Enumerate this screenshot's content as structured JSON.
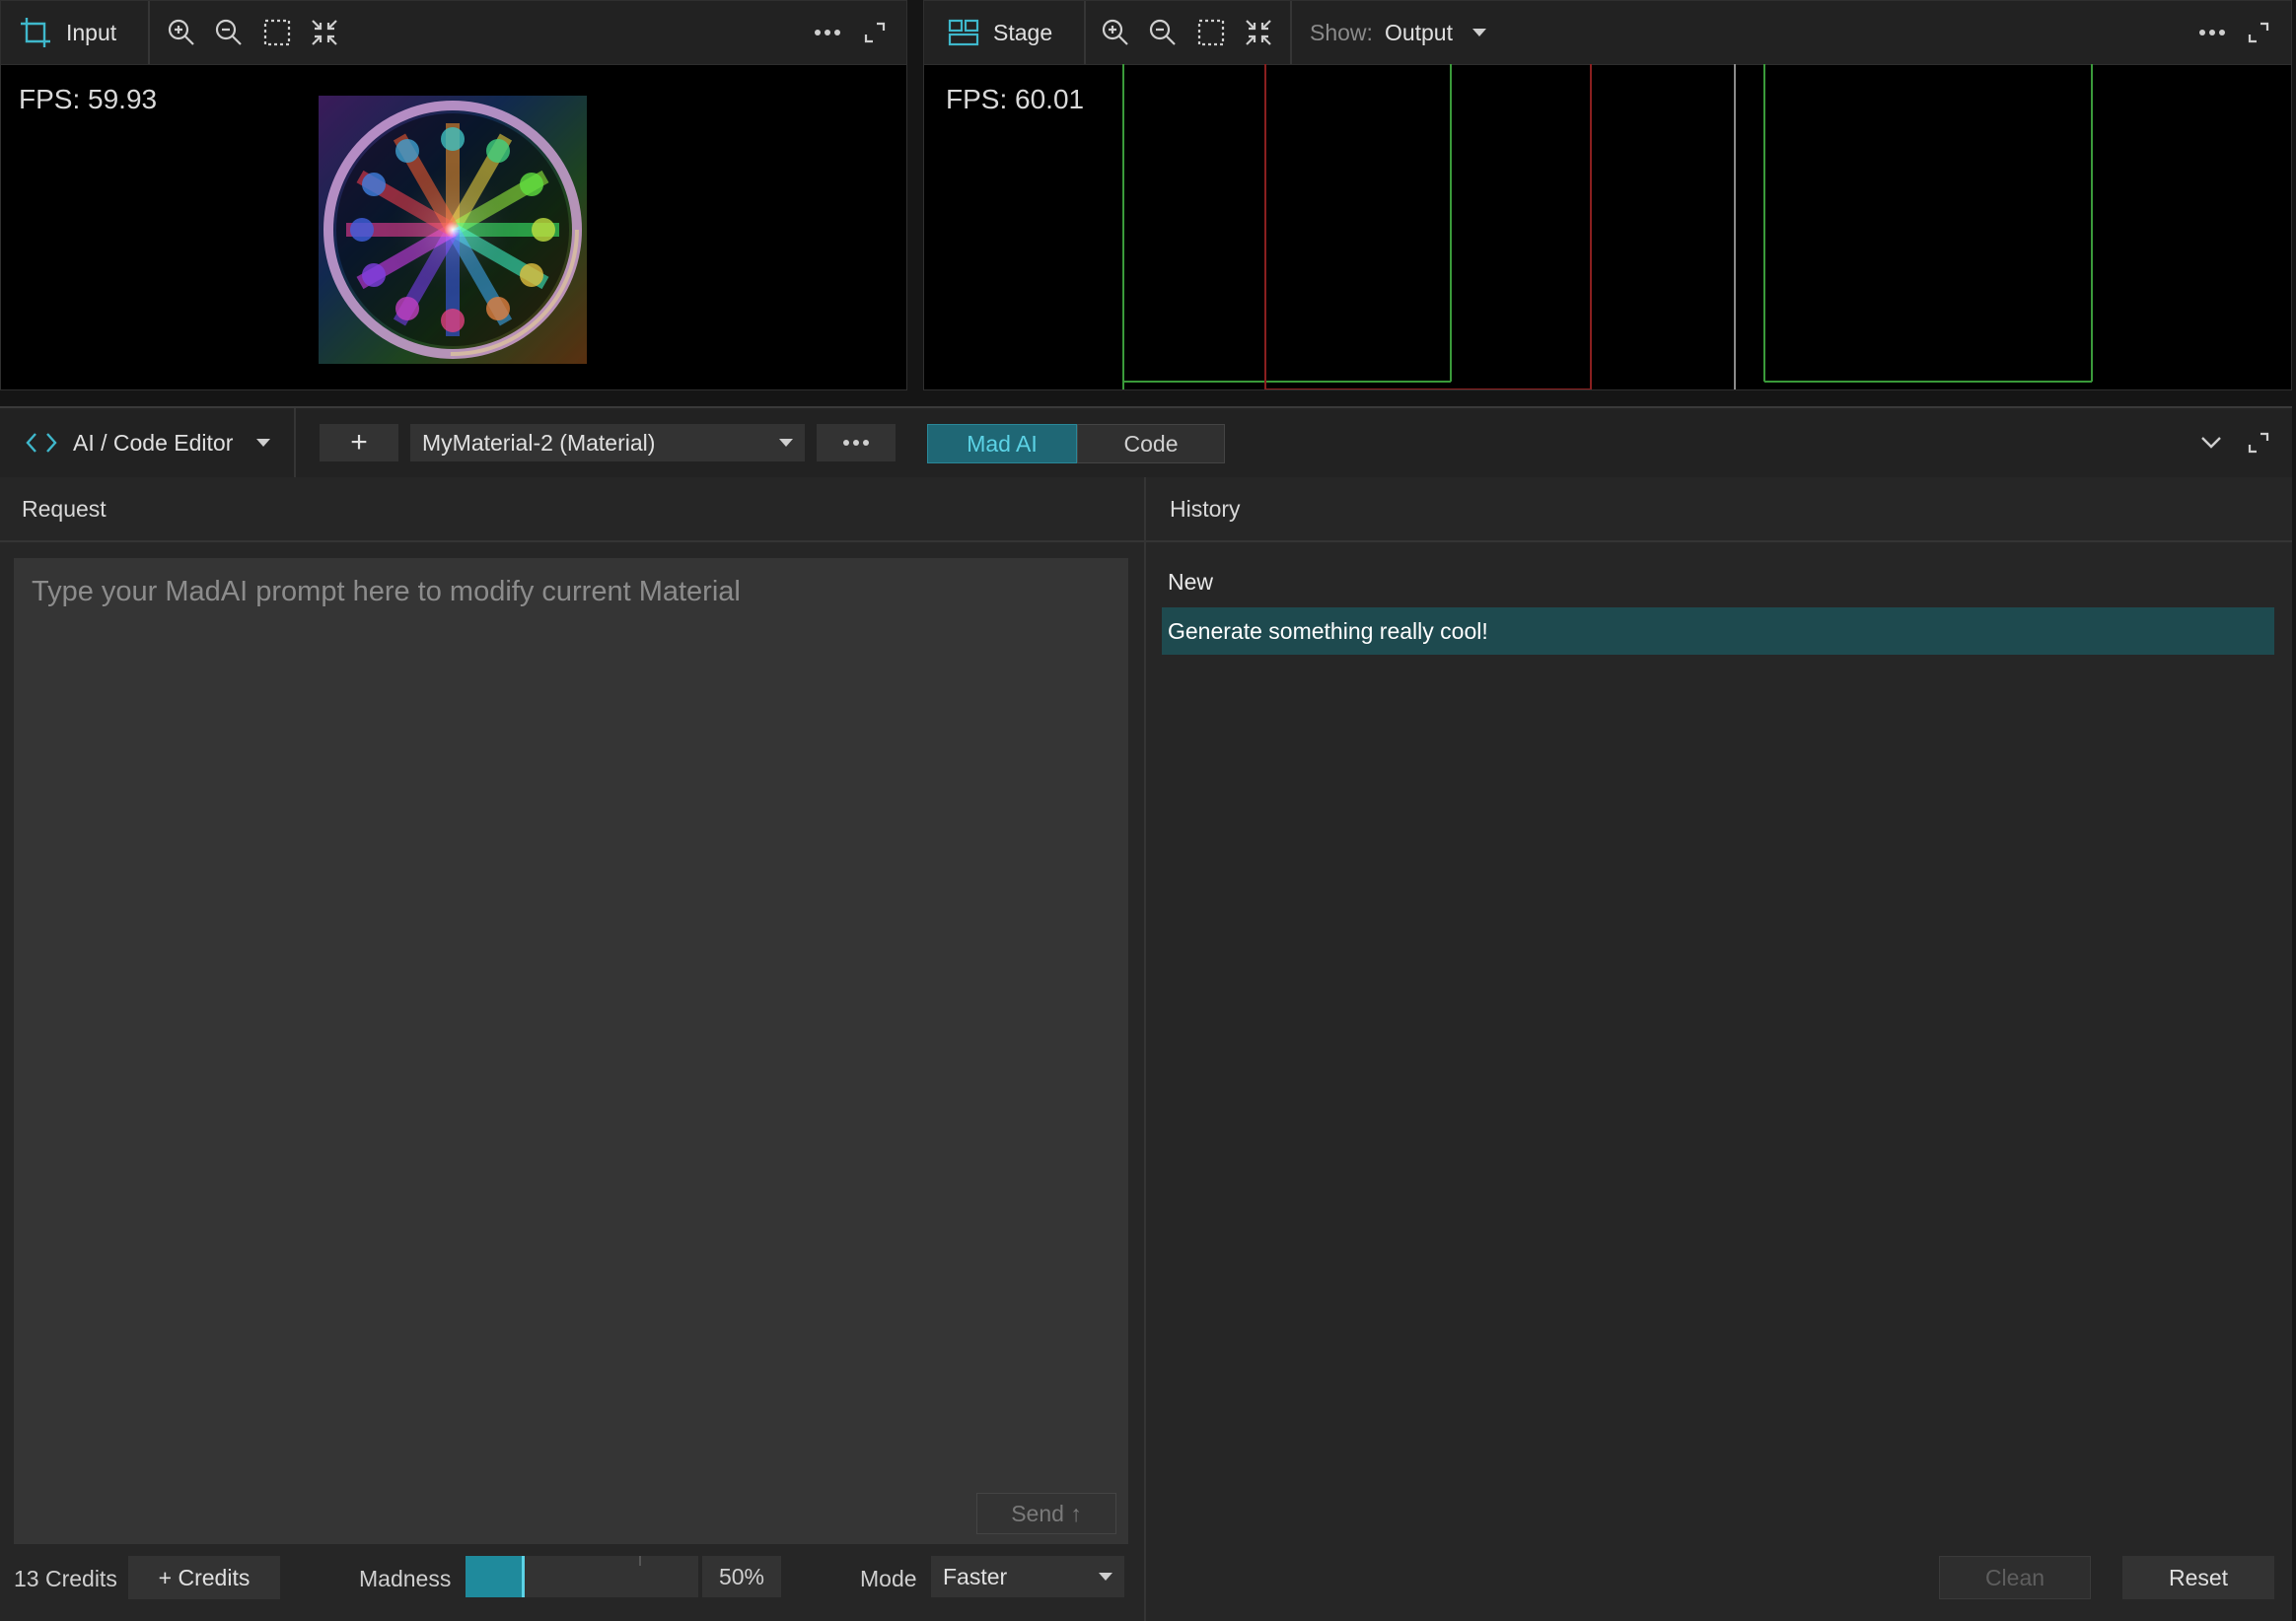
{
  "input_viewer": {
    "title": "Input",
    "fps": "FPS: 59.93"
  },
  "stage_viewer": {
    "title": "Stage",
    "fps": "FPS: 60.01",
    "show_label": "Show:",
    "show_value": "Output"
  },
  "editor": {
    "module_title": "AI / Code Editor",
    "add_label": "+",
    "material_selected": "MyMaterial-2 (Material)",
    "tabs": [
      {
        "label": "Mad AI",
        "active": true
      },
      {
        "label": "Code",
        "active": false
      }
    ],
    "request": {
      "header": "Request",
      "placeholder": "Type your MadAI prompt here to modify current Material",
      "send_label": "Send ↑"
    },
    "history": {
      "header": "History",
      "items": [
        {
          "label": "New",
          "selected": false
        },
        {
          "label": "Generate something really cool!",
          "selected": true
        }
      ],
      "clean_label": "Clean",
      "reset_label": "Reset"
    },
    "footer": {
      "credits": "13 Credits",
      "add_credits_label": "+ Credits",
      "madness_label": "Madness",
      "madness_value": 0.5,
      "madness_text": "50%",
      "mode_label": "Mode",
      "mode_value": "Faster"
    }
  },
  "colors": {
    "accent": "#2ba6b8",
    "active_tab_bg": "#1f6775",
    "selected_row_bg": "#1e4a4f",
    "stage_green": "#3a9a3a",
    "stage_red": "#8a1f1f"
  },
  "icons": [
    "crop-icon",
    "zoom-in-icon",
    "zoom-out-icon",
    "select-area-icon",
    "fit-view-icon",
    "more-icon",
    "expand-icon",
    "stage-layout-icon",
    "code-brackets-icon",
    "chevron-down-icon",
    "send-arrow-icon"
  ]
}
